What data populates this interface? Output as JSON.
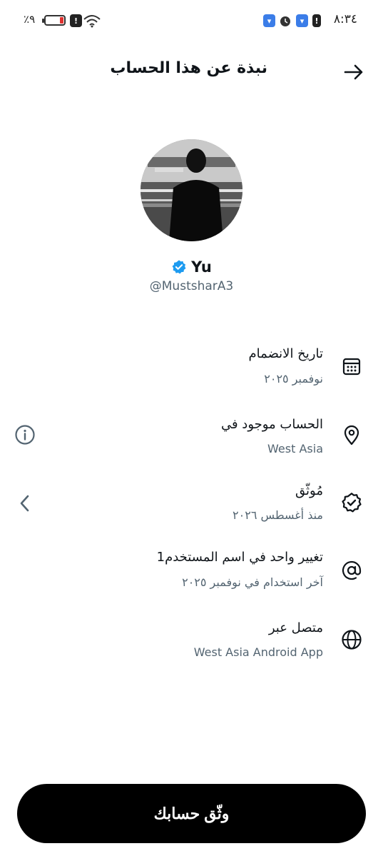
{
  "status_bar": {
    "time": "٨:٣٤",
    "battery_percent": "٪٩",
    "battery_level_fraction": 0.09,
    "icons": [
      "battery-charging-icon",
      "notification-blue-icon",
      "alarm-icon",
      "notification-blue-icon",
      "alert-icon",
      "alert-icon",
      "wifi-icon"
    ]
  },
  "header": {
    "title": "نبذة عن هذا الحساب",
    "back_icon": "arrow-right-icon"
  },
  "profile": {
    "display_name": "Yu",
    "handle": "@MustsharA3",
    "verified_badge_color": "#1d9bf0"
  },
  "rows": [
    {
      "title": "تاريخ الانضمام",
      "subtitle": "نوفمبر ٢٠٢٥",
      "icon": "calendar-icon"
    },
    {
      "title": "الحساب موجود في",
      "subtitle": "West Asia",
      "icon": "location-pin-icon",
      "left_icon": "info-icon"
    },
    {
      "title": "مُوثّق",
      "subtitle": "منذ أغسطس ٢٠٢٦",
      "icon": "verified-badge-icon",
      "left_icon": "chevron-left-icon"
    },
    {
      "title": "تغيير واحد في اسم المستخدم1",
      "subtitle": "آخر استخدام في نوفمبر ٢٠٢٥",
      "icon": "at-sign-icon"
    },
    {
      "title": "متصل عبر",
      "subtitle": "West Asia Android App",
      "icon": "globe-icon"
    }
  ],
  "verify_button": {
    "label": "وثّق حسابك"
  },
  "colors": {
    "text_primary": "#0f1419",
    "text_secondary": "#536471",
    "button_bg": "#000000",
    "verified_blue": "#1d9bf0"
  }
}
